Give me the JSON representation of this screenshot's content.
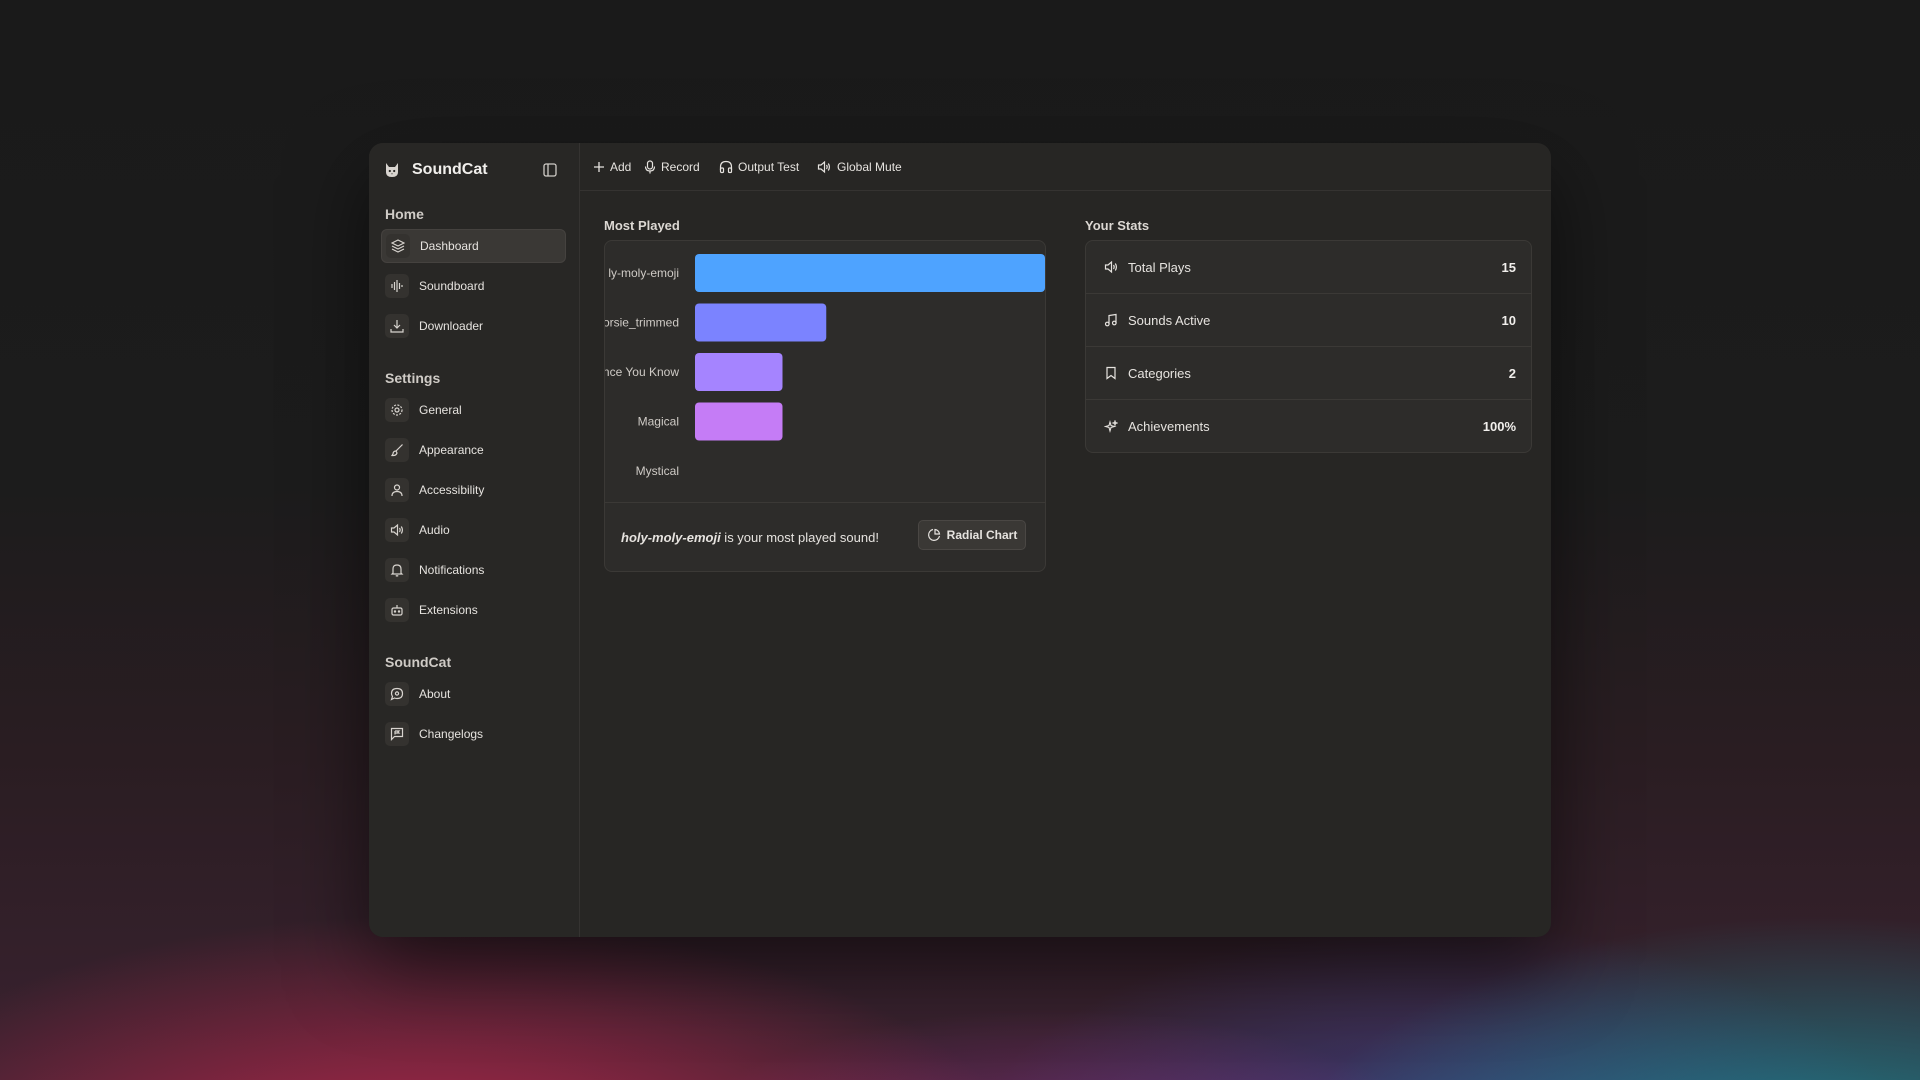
{
  "app": {
    "name": "SoundCat"
  },
  "toolbar": {
    "add_label": "Add",
    "record_label": "Record",
    "output_test_label": "Output Test",
    "global_mute_label": "Global Mute"
  },
  "sidebar": {
    "sections": [
      {
        "label": "Home"
      },
      {
        "label": "Settings"
      },
      {
        "label": "SoundCat"
      }
    ],
    "items": [
      {
        "label": "Dashboard",
        "icon": "layers-icon",
        "active": true
      },
      {
        "label": "Soundboard",
        "icon": "audio-waveform-icon"
      },
      {
        "label": "Downloader",
        "icon": "download-icon"
      },
      {
        "label": "General",
        "icon": "gear-icon"
      },
      {
        "label": "Appearance",
        "icon": "brush-icon"
      },
      {
        "label": "Accessibility",
        "icon": "person-icon"
      },
      {
        "label": "Audio",
        "icon": "speaker-icon"
      },
      {
        "label": "Notifications",
        "icon": "bell-icon"
      },
      {
        "label": "Extensions",
        "icon": "bot-icon"
      },
      {
        "label": "About",
        "icon": "chat-bubble-icon"
      },
      {
        "label": "Changelogs",
        "icon": "message-flag-icon"
      }
    ]
  },
  "most_played": {
    "title": "Most Played",
    "footer_sound": "holy-moly-emoji",
    "footer_suffix": " is your most played sound!",
    "radial_button_label": "Radial Chart"
  },
  "chart_data": {
    "type": "bar",
    "orientation": "horizontal",
    "categories": [
      "holy-moly-emoji",
      "horsie_trimmed",
      "Since You Know",
      "Magical",
      "Mystical"
    ],
    "category_labels_visible": [
      "ly-moly-emoji",
      "orsie_trimmed",
      "nce You Know",
      "Magical",
      "Mystical"
    ],
    "values": [
      4,
      1.5,
      1,
      1,
      0
    ],
    "colors": [
      "#4ea3ff",
      "#7b83ff",
      "#a584ff",
      "#c57cf6",
      "#d47af0"
    ],
    "xlim": [
      0,
      4
    ],
    "grid": false,
    "legend": "none"
  },
  "stats": {
    "title": "Your Stats",
    "rows": [
      {
        "label": "Total Plays",
        "value": "15",
        "icon": "speaker-icon"
      },
      {
        "label": "Sounds Active",
        "value": "10",
        "icon": "music-note-icon"
      },
      {
        "label": "Categories",
        "value": "2",
        "icon": "bookmark-icon"
      },
      {
        "label": "Achievements",
        "value": "100%",
        "icon": "sparkles-icon"
      }
    ]
  }
}
